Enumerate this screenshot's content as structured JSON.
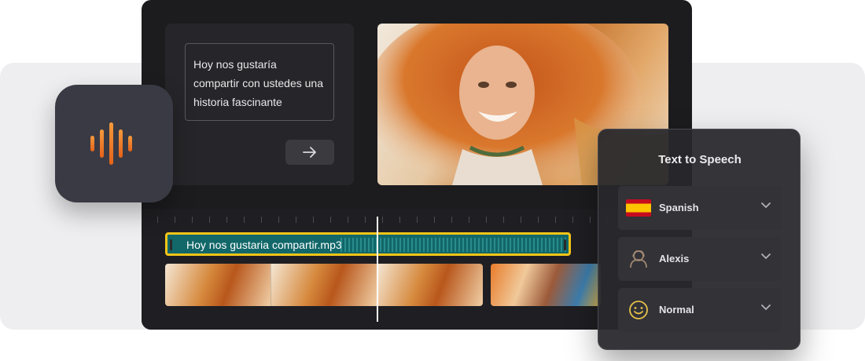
{
  "editor": {
    "script_text": "Hoy nos gustaría compartir con ustedes una historia fascinante",
    "next_button_icon": "arrow-right-icon"
  },
  "timeline": {
    "audio_clip_name": "Hoy nos gustaria compartir.mp3"
  },
  "app_icon": {
    "icon": "sound-wave-icon",
    "accent": "#f07a1a"
  },
  "tts_panel": {
    "title": "Text to Speech",
    "language": {
      "icon": "spain-flag-icon",
      "value": "Spanish"
    },
    "voice": {
      "icon": "avatar-icon",
      "value": "Alexis"
    },
    "style": {
      "icon": "smile-icon",
      "value": "Normal"
    }
  },
  "colors": {
    "highlight": "#f5c518",
    "audio_track": "#126769"
  }
}
